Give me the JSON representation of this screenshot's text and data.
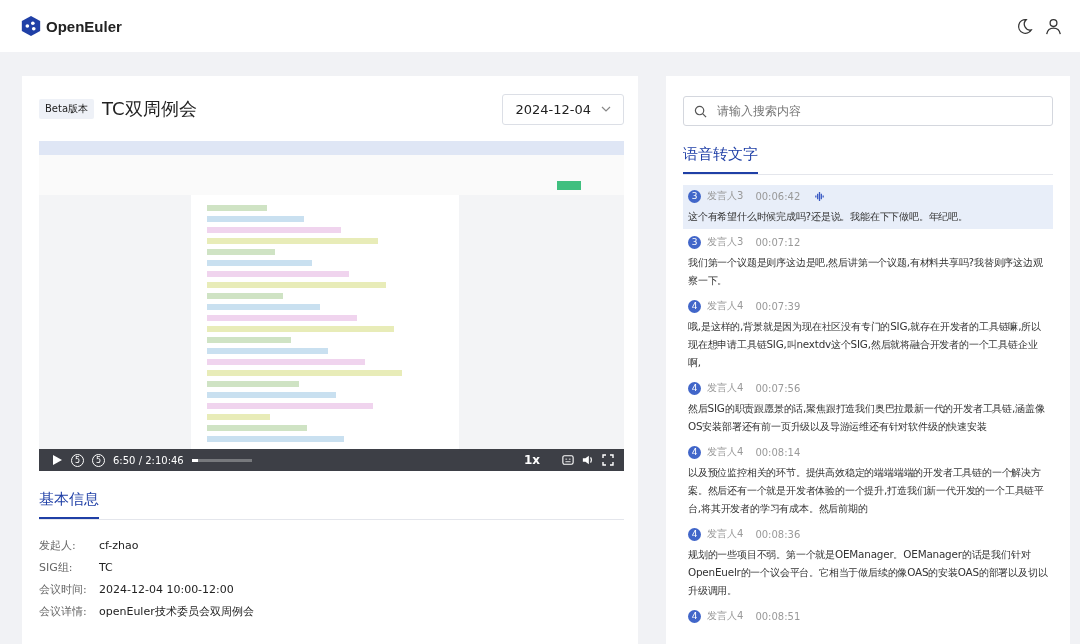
{
  "header": {
    "logo_text": "OpenEuler"
  },
  "meeting": {
    "badge": "Beta版本",
    "title": "TC双周例会",
    "date": "2024-12-04"
  },
  "video": {
    "time": "6:50 / 2:10:46",
    "level": 0.1,
    "speed": "1x",
    "rewind": "5",
    "forward": "5"
  },
  "info": {
    "tab": "基本信息",
    "rows": [
      {
        "label": "发起人:",
        "value": "cf-zhao"
      },
      {
        "label": "SIG组:",
        "value": "TC"
      },
      {
        "label": "会议时间:",
        "value": "2024-12-04 10:00-12:00"
      },
      {
        "label": "会议详情:",
        "value": "openEuler技术委员会双周例会"
      }
    ]
  },
  "transcript": {
    "search_placeholder": "请输入搜索内容",
    "tab": "语音转文字",
    "entries": [
      {
        "number": "3",
        "speaker": "发言人3",
        "time": "00:06:42",
        "selected": true,
        "playing": true,
        "text": "这个有希望什么时候完成吗?还是说。我能在下下做吧。年纪吧。"
      },
      {
        "number": "3",
        "speaker": "发言人3",
        "time": "00:07:12",
        "selected": false,
        "playing": false,
        "text": "我们第一个议题是则序这边是吧,然后讲第一个议题,有材料共享吗?我替则序这边观察一下。"
      },
      {
        "number": "4",
        "speaker": "发言人4",
        "time": "00:07:39",
        "selected": false,
        "playing": false,
        "text": "哦,是这样的,背景就是因为现在社区没有专门的SIG,就存在开发者的工具链嘛,所以现在想申请工具链SIG,叫nextdv这个SIG,然后就将融合开发者的一个工具链企业啊,"
      },
      {
        "number": "4",
        "speaker": "发言人4",
        "time": "00:07:56",
        "selected": false,
        "playing": false,
        "text": "然后SIG的职责跟愿景的话,聚焦跟打造我们奥巴拉最新一代的开发者工具链,涵盖像OS安装部署还有前一页升级以及导游运维还有针对软件级的快速安装"
      },
      {
        "number": "4",
        "speaker": "发言人4",
        "time": "00:08:14",
        "selected": false,
        "playing": false,
        "text": "以及预位监控相关的环节。提供高效稳定的端端端端的开发者工具链的一个解决方案。然后还有一个就是开发者体验的一个提升,打造我们新一代开发的一个工具链平台,将其开发者的学习有成本。然后前期的"
      },
      {
        "number": "4",
        "speaker": "发言人4",
        "time": "00:08:36",
        "selected": false,
        "playing": false,
        "text": "规划的一些项目不弱。第一个就是OEManager。OEManager的话是我们针对OpenEuelr的一个议会平台。它相当于做后续的像OAS的安装OAS的部署以及切以升级调用。"
      },
      {
        "number": "4",
        "speaker": "发言人4",
        "time": "00:08:51",
        "selected": false,
        "playing": false
      }
    ]
  }
}
